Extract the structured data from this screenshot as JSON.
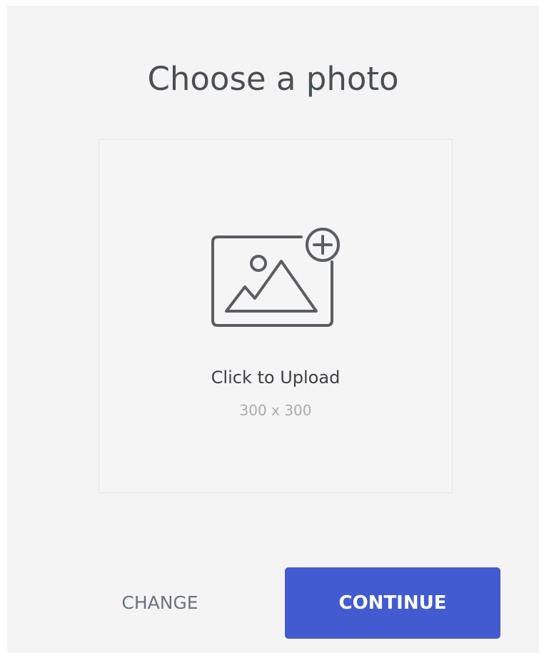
{
  "dialog": {
    "title": "Choose a photo"
  },
  "upload": {
    "label": "Click to Upload",
    "size": "300 x 300",
    "icon": "image-add-icon"
  },
  "actions": {
    "change_label": "CHANGE",
    "continue_label": "CONTINUE"
  },
  "colors": {
    "background": "#f4f4f4",
    "accent": "#435bd0",
    "title_text": "#4b4f54",
    "muted_text": "#a9acb0"
  }
}
